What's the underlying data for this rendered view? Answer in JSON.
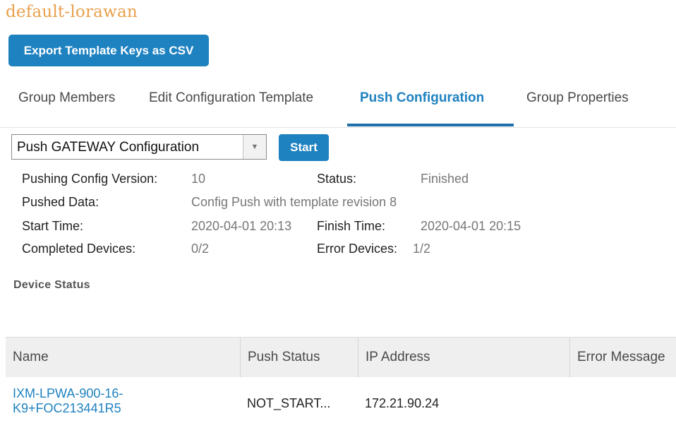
{
  "page": {
    "title": "default-lorawan"
  },
  "toolbar": {
    "export_label": "Export Template Keys as CSV"
  },
  "tabs": [
    {
      "label": "Group Members"
    },
    {
      "label": "Edit Configuration Template"
    },
    {
      "label": "Push Configuration"
    },
    {
      "label": "Group Properties"
    }
  ],
  "active_tab": "Push Configuration",
  "push": {
    "select_value": "Push GATEWAY Configuration",
    "start_label": "Start"
  },
  "info": {
    "version_label": "Pushing Config Version:",
    "version_value": "10",
    "status_label": "Status:",
    "status_value": "Finished",
    "pushed_label": "Pushed Data:",
    "pushed_value": "Config Push with template revision 8",
    "start_label": "Start Time:",
    "start_value": "2020-04-01 20:13",
    "finish_label": "Finish Time:",
    "finish_value": "2020-04-01 20:15",
    "completed_label": "Completed Devices:",
    "completed_value": "0/2",
    "errors_label": "Error Devices:",
    "errors_value": "1/2"
  },
  "device_status": {
    "heading": "Device Status",
    "columns": [
      "Name",
      "Push Status",
      "IP Address",
      "Error Message"
    ],
    "rows": [
      {
        "name_line1": "IXM-LPWA-900-16-",
        "name_line2": "K9+FOC213441R5",
        "push_status": "NOT_START...",
        "ip": "172.21.90.24"
      }
    ]
  },
  "colors": {
    "accent": "#1f82c0",
    "title": "#e9a04c"
  },
  "icons": {
    "select_arrow": "caret-down-icon"
  }
}
